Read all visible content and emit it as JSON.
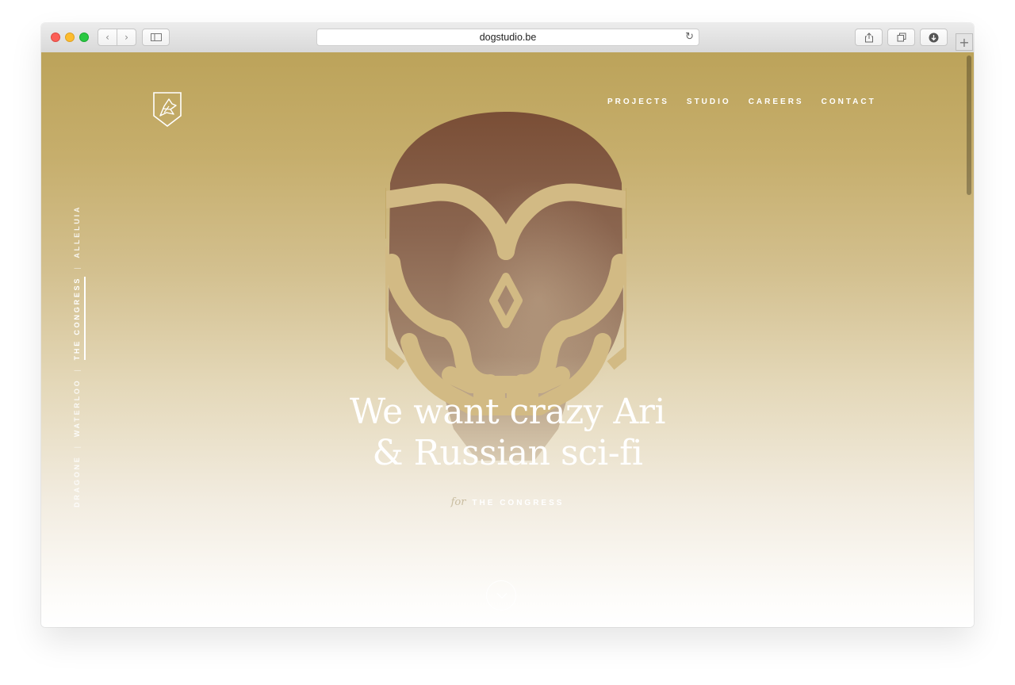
{
  "browser": {
    "url": "dogstudio.be",
    "back_icon": "‹",
    "forward_icon": "›",
    "reload_icon": "↻",
    "new_tab_icon": "+"
  },
  "site": {
    "nav": [
      "PROJECTS",
      "STUDIO",
      "CAREERS",
      "CONTACT"
    ],
    "side_nav": {
      "items": [
        "DRAGONE",
        "WATERLOO",
        "THE CONGRESS",
        "ALLELUIA"
      ],
      "active": "THE CONGRESS"
    },
    "headline_line1": "We want crazy Ari",
    "headline_line2": "& Russian sci-fi",
    "for_label": "for",
    "project_name": "THE CONGRESS"
  },
  "colors": {
    "gradient_top": "#bca35a",
    "gradient_bottom": "#ffffff",
    "skull_photo": "#7a4e36",
    "text": "#ffffff"
  }
}
